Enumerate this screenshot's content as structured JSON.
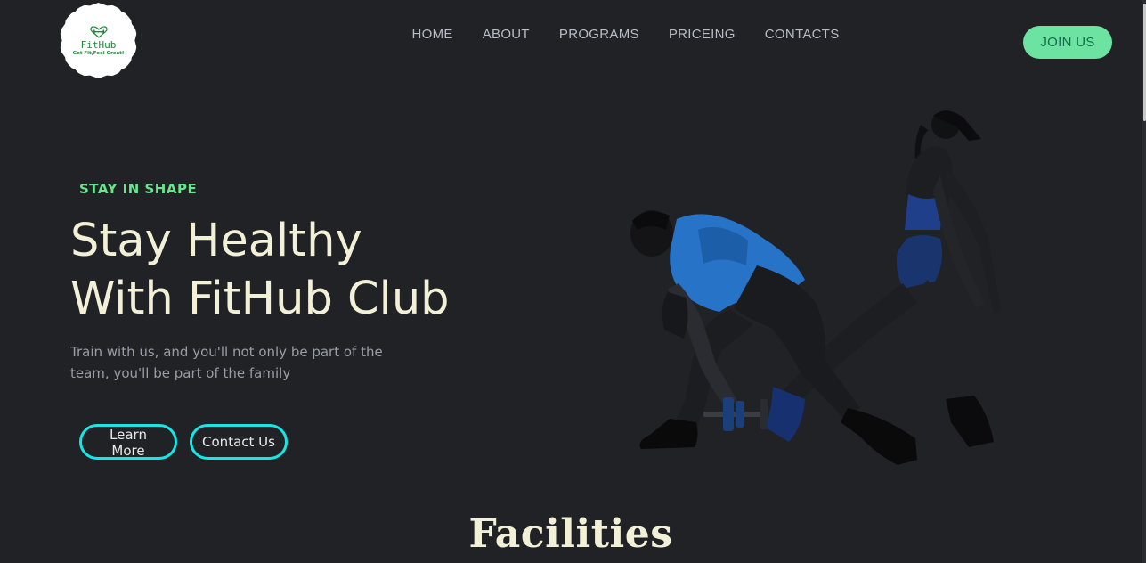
{
  "logo": {
    "name": "FitHub",
    "tagline": "Get Fit,Feel Great!"
  },
  "nav": {
    "items": [
      {
        "label": "HOME"
      },
      {
        "label": "ABOUT"
      },
      {
        "label": "PROGRAMS"
      },
      {
        "label": "PRICEING"
      },
      {
        "label": "CONTACTS"
      }
    ],
    "join_label": "JOIN US"
  },
  "hero": {
    "eyebrow": "STAY IN SHAPE",
    "title_line1": "Stay Healthy",
    "title_line2": "With FitHub Club",
    "desc_line1": "Train with us, and you'll not only be part of the",
    "desc_line2": "team, you'll be part of the family",
    "learn_more_label": "Learn More",
    "contact_label": "Contact Us"
  },
  "facilities": {
    "title": "Facilities"
  },
  "colors": {
    "background": "#202226",
    "accent_green": "#6ce38c",
    "button_green": "#6ce3a0",
    "outline_cyan": "#17e6e6",
    "heading": "#f3f0d8"
  }
}
